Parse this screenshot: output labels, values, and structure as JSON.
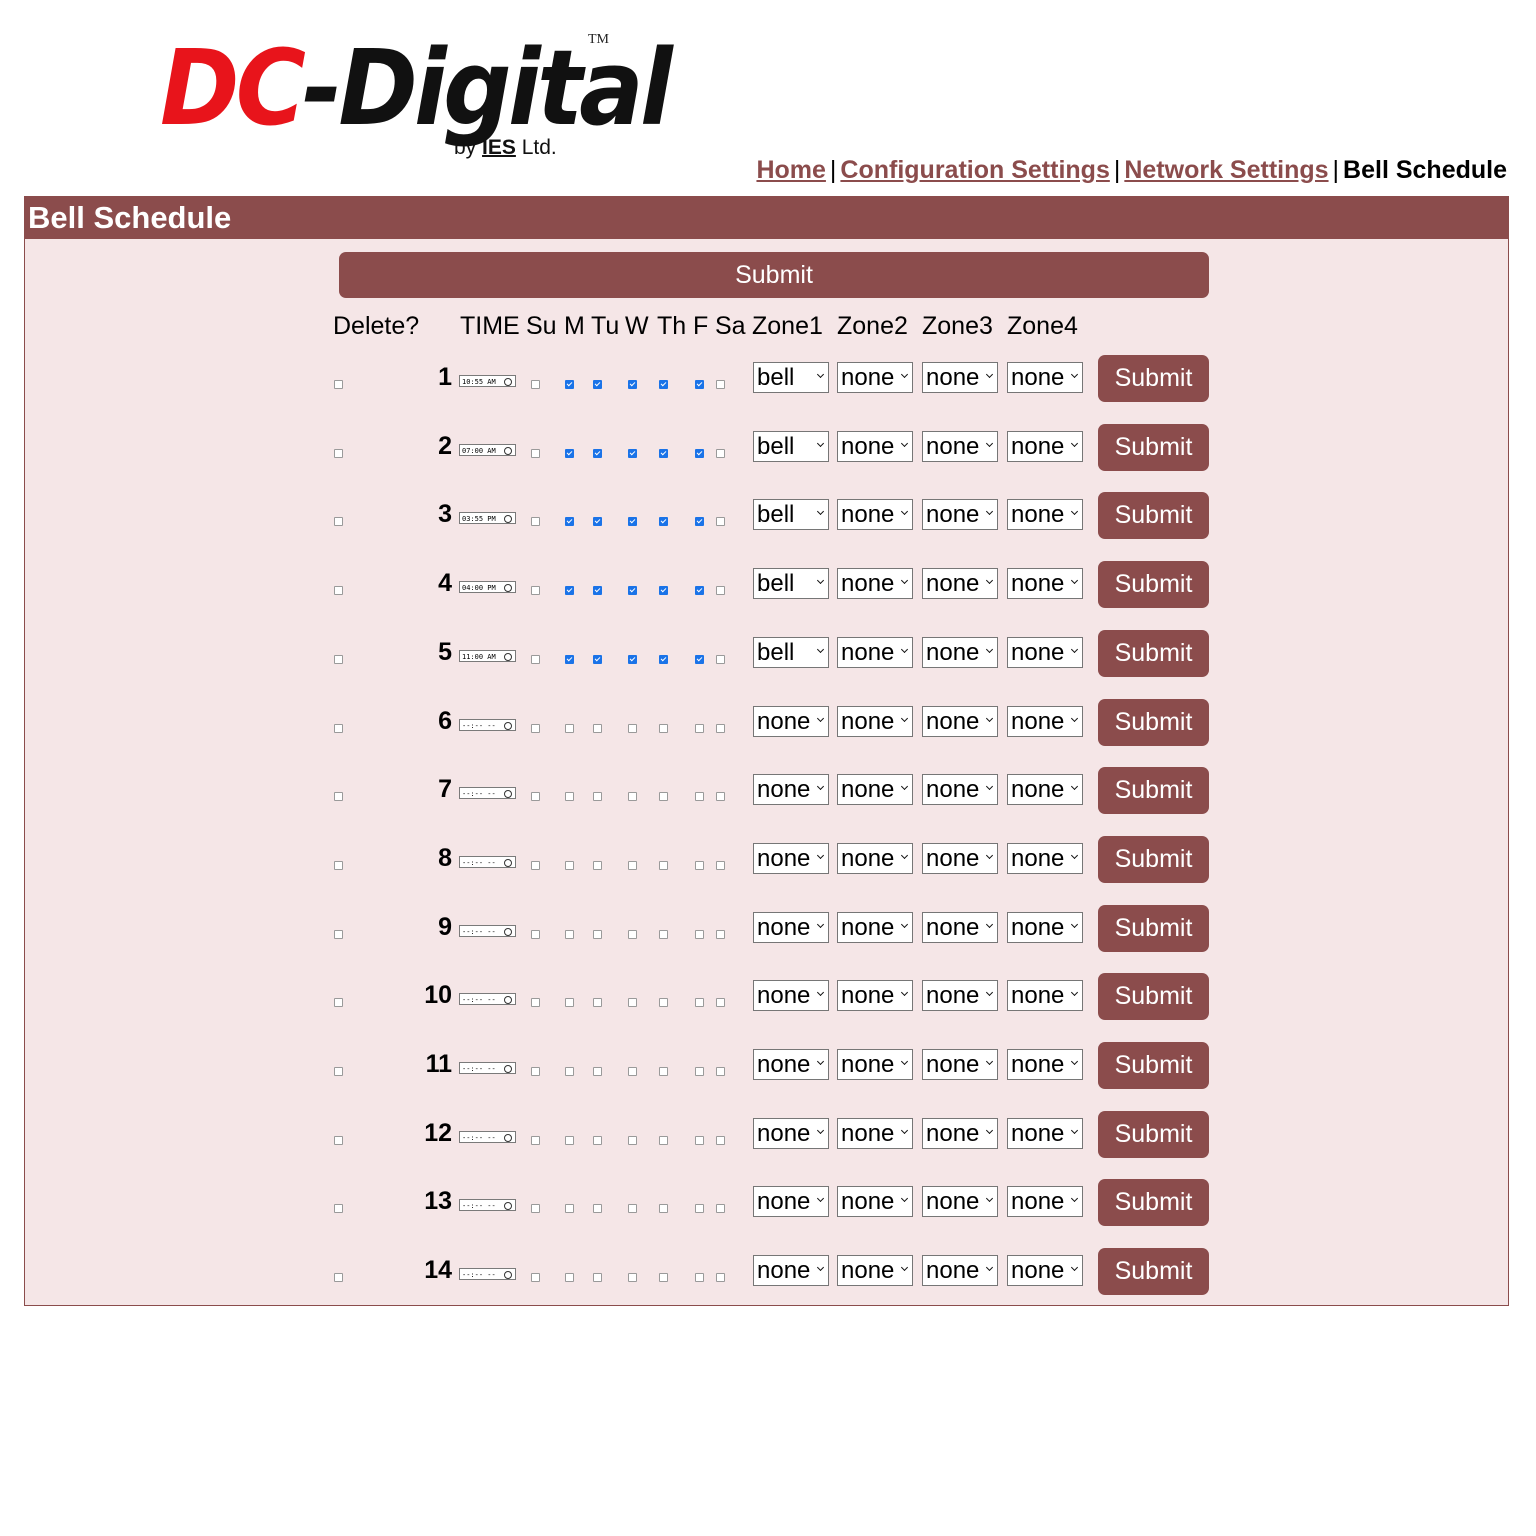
{
  "logo": {
    "part1": "DC",
    "part2": "-Digital",
    "tm": "TM",
    "by": "by",
    "ies": "IES",
    "ltd": "Ltd."
  },
  "nav": {
    "home": "Home",
    "config": "Configuration Settings",
    "network": "Network Settings",
    "current": "Bell Schedule",
    "separator": "|"
  },
  "panel": {
    "title": "Bell Schedule",
    "submit_all": "Submit"
  },
  "headers": {
    "delete": "Delete?",
    "time": "TIME",
    "days": [
      "Su",
      "M",
      "Tu",
      "W",
      "Th",
      "F",
      "Sa"
    ],
    "zones": [
      "Zone1",
      "Zone2",
      "Zone3",
      "Zone4"
    ]
  },
  "row_submit": "Submit",
  "rows": [
    {
      "num": "1",
      "time": "10:55 AM",
      "days": [
        false,
        true,
        true,
        true,
        true,
        true,
        false
      ],
      "zones": [
        "bell",
        "none",
        "none",
        "none"
      ]
    },
    {
      "num": "2",
      "time": "07:00 AM",
      "days": [
        false,
        true,
        true,
        true,
        true,
        true,
        false
      ],
      "zones": [
        "bell",
        "none",
        "none",
        "none"
      ]
    },
    {
      "num": "3",
      "time": "03:55 PM",
      "days": [
        false,
        true,
        true,
        true,
        true,
        true,
        false
      ],
      "zones": [
        "bell",
        "none",
        "none",
        "none"
      ]
    },
    {
      "num": "4",
      "time": "04:00 PM",
      "days": [
        false,
        true,
        true,
        true,
        true,
        true,
        false
      ],
      "zones": [
        "bell",
        "none",
        "none",
        "none"
      ]
    },
    {
      "num": "5",
      "time": "11:00 AM",
      "days": [
        false,
        true,
        true,
        true,
        true,
        true,
        false
      ],
      "zones": [
        "bell",
        "none",
        "none",
        "none"
      ]
    },
    {
      "num": "6",
      "time": "--:-- --",
      "days": [
        false,
        false,
        false,
        false,
        false,
        false,
        false
      ],
      "zones": [
        "none",
        "none",
        "none",
        "none"
      ]
    },
    {
      "num": "7",
      "time": "--:-- --",
      "days": [
        false,
        false,
        false,
        false,
        false,
        false,
        false
      ],
      "zones": [
        "none",
        "none",
        "none",
        "none"
      ]
    },
    {
      "num": "8",
      "time": "--:-- --",
      "days": [
        false,
        false,
        false,
        false,
        false,
        false,
        false
      ],
      "zones": [
        "none",
        "none",
        "none",
        "none"
      ]
    },
    {
      "num": "9",
      "time": "--:-- --",
      "days": [
        false,
        false,
        false,
        false,
        false,
        false,
        false
      ],
      "zones": [
        "none",
        "none",
        "none",
        "none"
      ]
    },
    {
      "num": "10",
      "time": "--:-- --",
      "days": [
        false,
        false,
        false,
        false,
        false,
        false,
        false
      ],
      "zones": [
        "none",
        "none",
        "none",
        "none"
      ]
    },
    {
      "num": "11",
      "time": "--:-- --",
      "days": [
        false,
        false,
        false,
        false,
        false,
        false,
        false
      ],
      "zones": [
        "none",
        "none",
        "none",
        "none"
      ]
    },
    {
      "num": "12",
      "time": "--:-- --",
      "days": [
        false,
        false,
        false,
        false,
        false,
        false,
        false
      ],
      "zones": [
        "none",
        "none",
        "none",
        "none"
      ]
    },
    {
      "num": "13",
      "time": "--:-- --",
      "days": [
        false,
        false,
        false,
        false,
        false,
        false,
        false
      ],
      "zones": [
        "none",
        "none",
        "none",
        "none"
      ]
    },
    {
      "num": "14",
      "time": "--:-- --",
      "days": [
        false,
        false,
        false,
        false,
        false,
        false,
        false
      ],
      "zones": [
        "none",
        "none",
        "none",
        "none"
      ]
    }
  ],
  "colors": {
    "accent": "#8b4c4c",
    "panel_bg": "#f5e6e7",
    "check_on": "#1a73e8",
    "logo_red": "#e8141b"
  }
}
